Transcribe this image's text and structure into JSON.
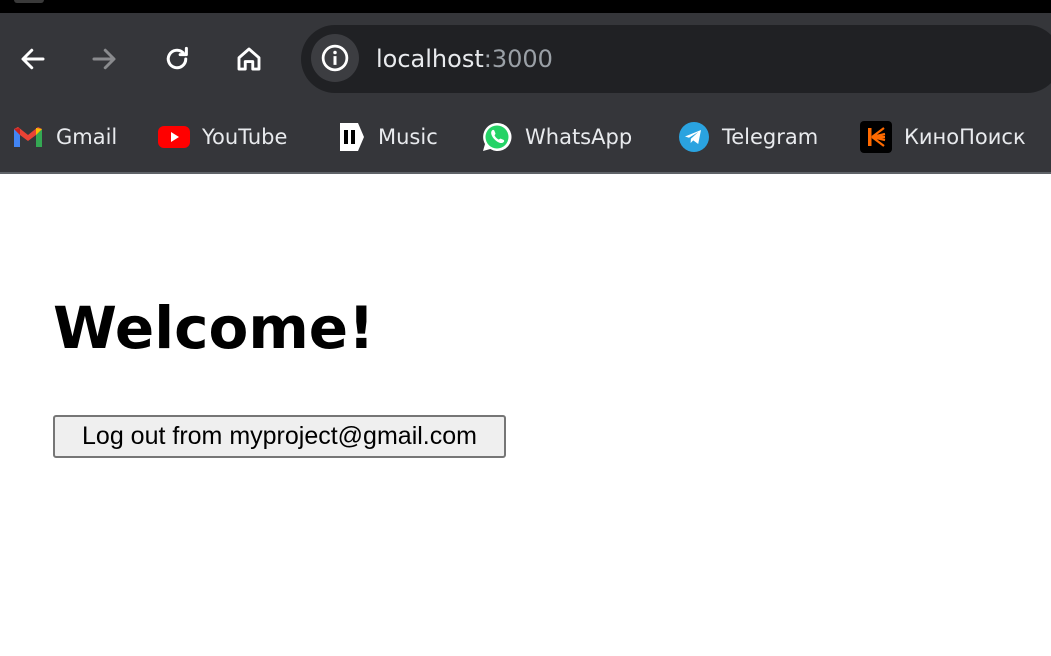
{
  "browser": {
    "address_bar": {
      "host": "localhost",
      "port": ":3000"
    },
    "bookmarks": [
      {
        "label": "Gmail",
        "icon": "gmail-icon"
      },
      {
        "label": "YouTube",
        "icon": "youtube-icon"
      },
      {
        "label": "Music",
        "icon": "music-icon"
      },
      {
        "label": "WhatsApp",
        "icon": "whatsapp-icon"
      },
      {
        "label": "Telegram",
        "icon": "telegram-icon"
      },
      {
        "label": "КиноПоиск",
        "icon": "kinopoisk-icon"
      }
    ],
    "colors": {
      "toolbar_bg": "#35363a",
      "omnibox_bg": "#202124",
      "text": "#e8eaed",
      "muted": "#9aa0a6"
    }
  },
  "page": {
    "heading": "Welcome!",
    "logout_button_label": "Log out from myproject@gmail.com"
  }
}
